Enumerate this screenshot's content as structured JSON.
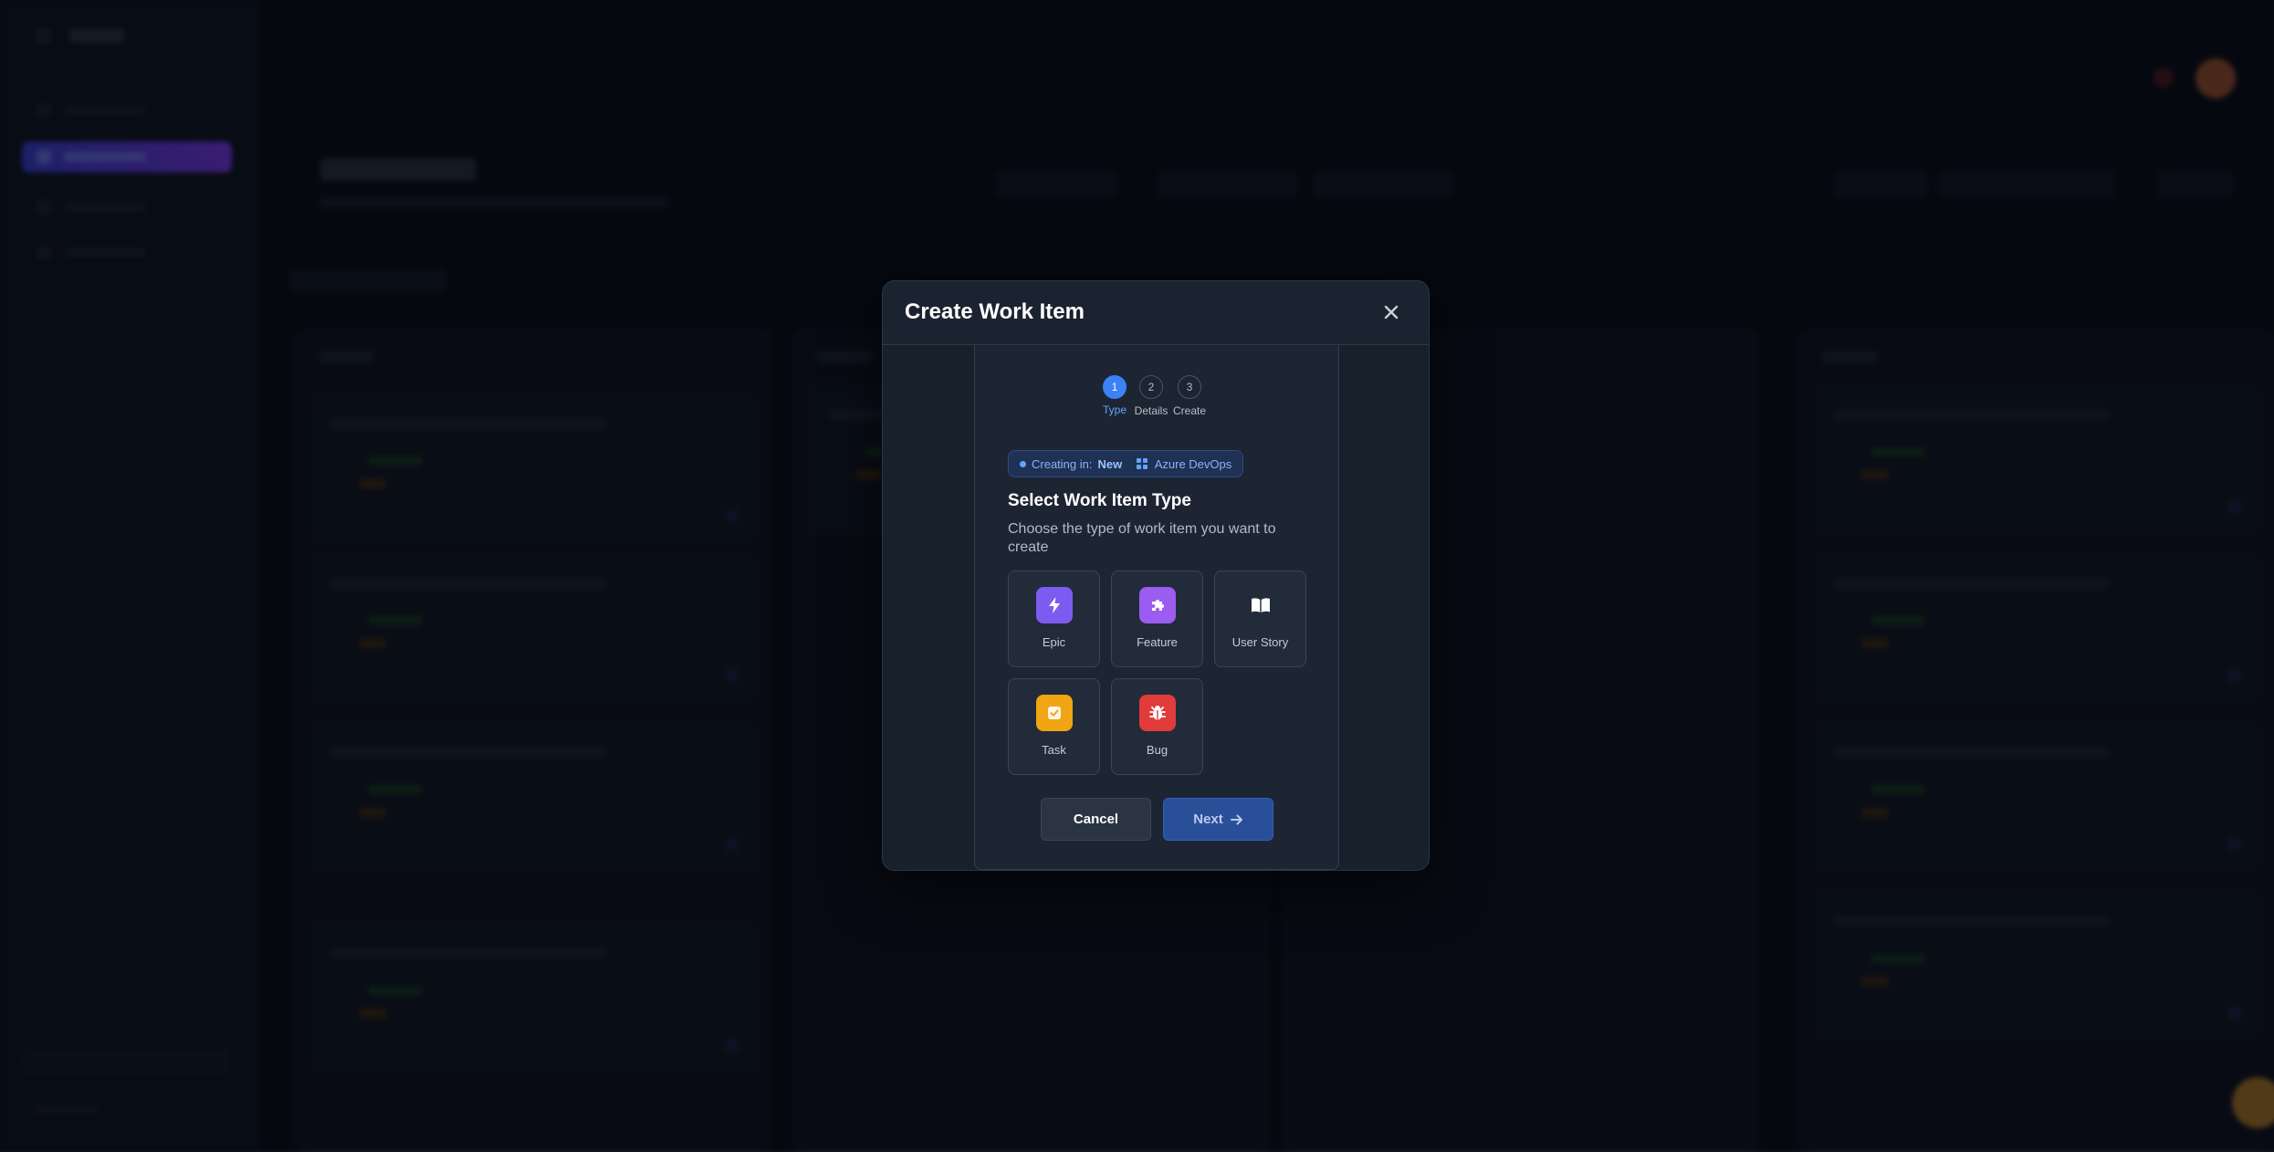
{
  "modal": {
    "title": "Create Work Item",
    "close_icon": "close-icon"
  },
  "stepper": {
    "steps": [
      {
        "number": "1",
        "label": "Type",
        "active": true
      },
      {
        "number": "2",
        "label": "Details",
        "active": false
      },
      {
        "number": "3",
        "label": "Create",
        "active": false
      }
    ]
  },
  "context": {
    "prefix": "Creating in:",
    "column": "New",
    "provider": "Azure DevOps",
    "provider_icon": "grid-icon"
  },
  "section": {
    "title": "Select Work Item Type",
    "subtitle": "Choose the type of work item you want to create"
  },
  "types": [
    {
      "name": "Epic",
      "icon": "lightning-icon",
      "color": "#7c5cf0"
    },
    {
      "name": "Feature",
      "icon": "puzzle-icon",
      "color": "#9b5cf0"
    },
    {
      "name": "User Story",
      "icon": "book-icon",
      "color": "#222b3a"
    },
    {
      "name": "Task",
      "icon": "checkbox-icon",
      "color": "#f0a513"
    },
    {
      "name": "Bug",
      "icon": "bug-icon",
      "color": "#e23b3b"
    }
  ],
  "buttons": {
    "cancel": "Cancel",
    "next": "Next"
  },
  "colors": {
    "accent": "#3b82f6",
    "modal_bg": "#1b2330",
    "next_bg": "#2a4f99"
  }
}
